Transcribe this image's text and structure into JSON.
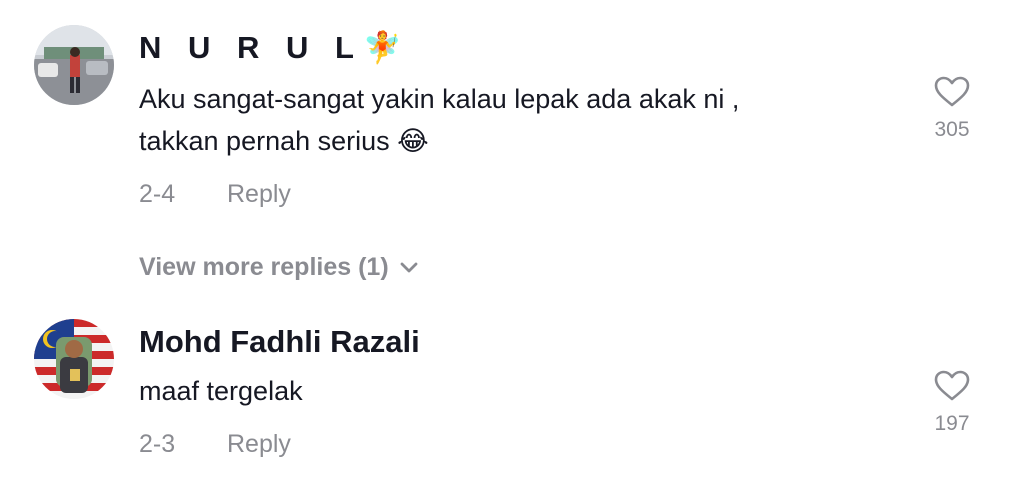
{
  "comments": [
    {
      "username": "N U R U L",
      "username_emoji": "🧚",
      "text_line1": "Aku sangat-sangat yakin kalau lepak ada akak ni ,",
      "text_line2": "takkan pernah serius",
      "text_emoji": "😂",
      "date": "2-4",
      "reply_label": "Reply",
      "like_count": "305",
      "heart_icon": "heart-outline-icon"
    },
    {
      "username": "Mohd Fadhli Razali",
      "text_line1": "maaf tergelak",
      "date": "2-3",
      "reply_label": "Reply",
      "like_count": "197",
      "heart_icon": "heart-outline-icon"
    }
  ],
  "view_more": {
    "label": "View more replies (1)",
    "icon": "chevron-down-icon"
  },
  "colors": {
    "text_primary": "#161823",
    "text_secondary": "#8a8b91",
    "background": "#ffffff"
  }
}
